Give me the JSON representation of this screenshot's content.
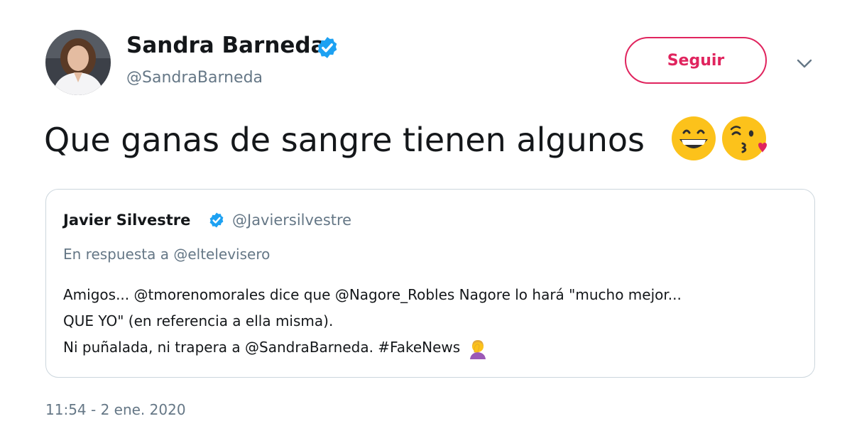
{
  "author": {
    "name": "Sandra Barneda",
    "handle": "@SandraBarneda",
    "verified": true
  },
  "follow_button": {
    "label": "Seguir"
  },
  "menu": {
    "icon": "chevron-down-icon"
  },
  "tweet": {
    "text": "Que ganas de sangre tienen algunos",
    "emojis": [
      "grinning-face-icon",
      "kissing-face-heart-icon"
    ]
  },
  "quoted_tweet": {
    "author_name": "Javier Silvestre",
    "author_handle": "@Javiersilvestre",
    "verified": true,
    "reply_context": "En respuesta a @eltelevisero",
    "lines": [
      "Amigos... @tmorenomorales dice que @Nagore_Robles Nagore lo hará \"mucho mejor...",
      "QUE YO\" (en referencia a ella misma).",
      "Ni puñalada, ni trapera a @SandraBarneda. #FakeNews"
    ],
    "trailing_emoji": "facepalm-icon"
  },
  "timestamp": "11:54 - 2 ene. 2020",
  "colors": {
    "follow_accent": "#e0245e",
    "verified_blue": "#1da1f2",
    "secondary_text": "#657786",
    "primary_text": "#14171a",
    "border": "#ccd6dd"
  }
}
